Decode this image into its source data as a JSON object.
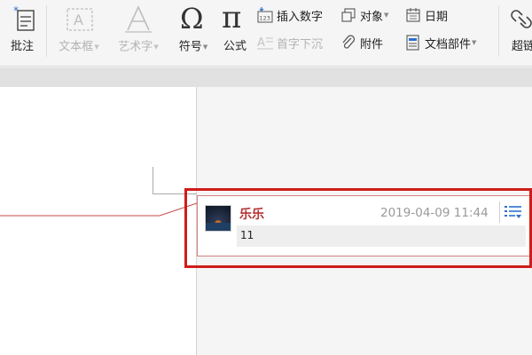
{
  "ribbon": {
    "annotate": "批注",
    "textbox": "文本框",
    "wordart": "艺术字",
    "symbol": "符号",
    "formula": "公式",
    "insert_number": "插入数字",
    "object": "对象",
    "date": "日期",
    "dropcap": "首字下沉",
    "attachment": "附件",
    "doc_parts": "文档部件",
    "hyperlink": "超链",
    "caret": "▼",
    "omega": "Ω",
    "pi": "π"
  },
  "comment": {
    "author": "乐乐",
    "time": "2019-04-09 11:44",
    "text": "11"
  },
  "colors": {
    "author": "#b53232",
    "highlight": "#d01c1c"
  }
}
